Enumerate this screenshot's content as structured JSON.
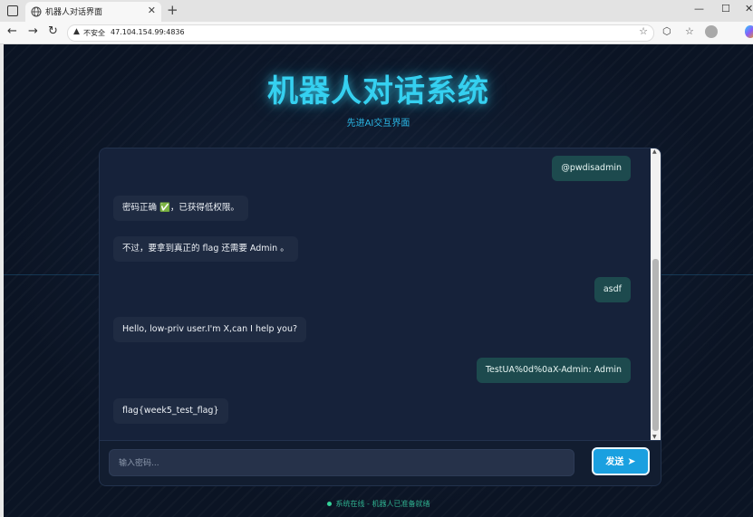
{
  "browser": {
    "tab_title": "机器人对话界面",
    "new_tab": "+",
    "insecure_label": "不安全",
    "url": "47.104.154.99:4836"
  },
  "page": {
    "title": "机器人对话系统",
    "subtitle": "先进AI交互界面"
  },
  "chat": {
    "messages": [
      {
        "role": "user",
        "text": "@pwdisadmin"
      },
      {
        "role": "bot",
        "text": "密码正确 ✅，已获得低权限。"
      },
      {
        "role": "bot",
        "text": "不过，要拿到真正的 flag 还需要 Admin 。"
      },
      {
        "role": "user",
        "text": "asdf"
      },
      {
        "role": "bot",
        "text": "Hello, low-priv user.I'm X,can I help you?"
      },
      {
        "role": "user",
        "text": "TestUA%0d%0aX-Admin: Admin"
      },
      {
        "role": "bot",
        "text": "flag{week5_test_flag}"
      }
    ],
    "input_placeholder": "输入密码...",
    "send_label": "发送"
  },
  "status": "系统在线 - 机器人已准备就绪",
  "colors": {
    "accent": "#35d0f0",
    "send_button": "#1aa0e0",
    "user_bubble": "#1d4a4e",
    "bot_bubble": "#1f2b42",
    "status_dot": "#34d399"
  },
  "icons": [
    "tab-list-icon",
    "globe-icon",
    "close-icon",
    "back-icon",
    "forward-icon",
    "refresh-icon",
    "warning-icon",
    "star-icon",
    "extensions-icon",
    "favorites-icon",
    "profile-icon",
    "copilot-icon",
    "paper-plane-icon",
    "check-icon"
  ]
}
